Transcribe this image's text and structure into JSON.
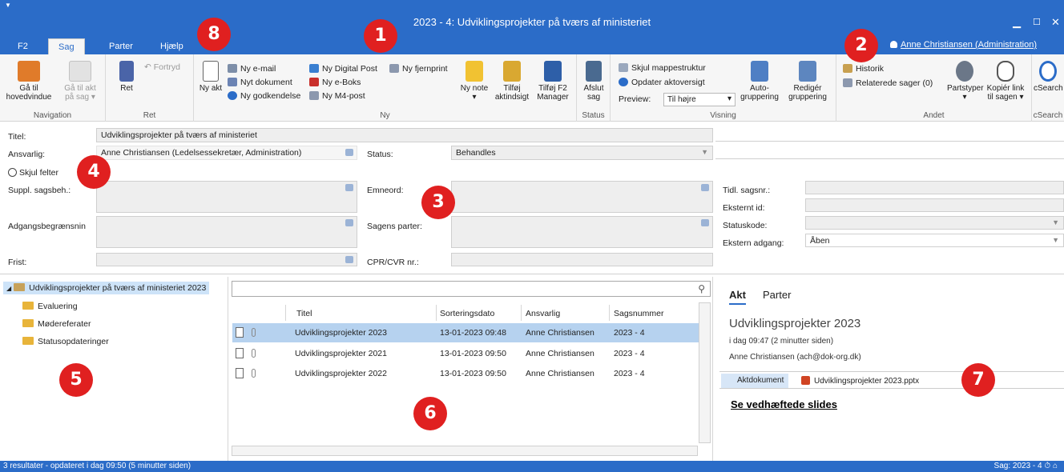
{
  "window": {
    "title": "2023 - 4: Udviklingsprojekter på tværs af ministeriet",
    "tabs": [
      {
        "label": "F2"
      },
      {
        "label": "Sag"
      },
      {
        "label": "Parter"
      },
      {
        "label": "Hjælp"
      }
    ],
    "user": "Anne Christiansen (Administration)"
  },
  "ribbon": {
    "navigation": {
      "label": "Navigation",
      "go_home": "Gå til hovedvindue",
      "go_akt": "Gå til akt på sag ▾"
    },
    "ret": {
      "label": "Ret",
      "ret": "Ret",
      "fortryd": "Fortryd"
    },
    "ny": {
      "label": "Ny",
      "ny_akt": "Ny akt",
      "ny_email": "Ny e-mail",
      "nyt_dokument": "Nyt dokument",
      "ny_godkendelse": "Ny godkendelse",
      "ny_digital_post": "Ny Digital Post",
      "ny_eboks": "Ny e-Boks",
      "ny_m4post": "Ny M4-post",
      "ny_fjernprint": "Ny fjernprint",
      "ny_note": "Ny note ▾",
      "tilfoej_aktindsigt": "Tilføj aktindsigt",
      "tilfoej_f2_manager": "Tilføj F2 Manager"
    },
    "status": {
      "label": "Status",
      "afslut_sag": "Afslut sag"
    },
    "visning": {
      "label": "Visning",
      "skjul_mappestruktur": "Skjul mappestruktur",
      "opdater_aktoversigt": "Opdater aktoversigt",
      "preview_label": "Preview:",
      "preview_value": "Til højre",
      "auto_gruppering": "Auto- gruppering",
      "rediger_gruppering": "Redigér gruppering"
    },
    "andet": {
      "label": "Andet",
      "historik": "Historik",
      "relaterede_sager": "Relaterede sager (0)",
      "partstyper": "Partstyper ▾",
      "kopier_link": "Kopiér link til sagen ▾"
    },
    "csearch": {
      "label": "cSearch",
      "csearch": "cSearch"
    }
  },
  "form": {
    "titel_label": "Titel:",
    "titel_value": "Udviklingsprojekter på tværs af ministeriet",
    "ansvarlig_label": "Ansvarlig:",
    "ansvarlig_value": "Anne Christiansen (Ledelsessekretær, Administration)",
    "status_label": "Status:",
    "status_value": "Behandles",
    "skjul_felter": "Skjul felter",
    "suppl_label": "Suppl. sagsbeh.:",
    "emneord_label": "Emneord:",
    "tidl_sagsnr_label": "Tidl. sagsnr.:",
    "eksternt_id_label": "Eksternt id:",
    "statuskode_label": "Statuskode:",
    "ekstern_adgang_label": "Ekstern adgang:",
    "ekstern_adgang_value": "Åben",
    "adgangsbegraensning_label": "Adgangsbegrænsnin",
    "sagens_parter_label": "Sagens parter:",
    "frist_label": "Frist:",
    "cpr_label": "CPR/CVR nr.:"
  },
  "tree": {
    "root": "Udviklingsprojekter på tværs af ministeriet 2023",
    "children": [
      "Evaluering",
      "Mødereferater",
      "Statusopdateringer"
    ]
  },
  "list": {
    "columns": [
      "Titel",
      "Sorteringsdato",
      "Ansvarlig",
      "Sagsnummer"
    ],
    "rows": [
      {
        "titel": "Udviklingsprojekter 2023",
        "dato": "13-01-2023 09:48",
        "ansvarlig": "Anne Christiansen",
        "sagsnummer": "2023 - 4"
      },
      {
        "titel": "Udviklingsprojekter 2021",
        "dato": "13-01-2023 09:50",
        "ansvarlig": "Anne Christiansen",
        "sagsnummer": "2023 - 4"
      },
      {
        "titel": "Udviklingsprojekter 2022",
        "dato": "13-01-2023 09:50",
        "ansvarlig": "Anne Christiansen",
        "sagsnummer": "2023 - 4"
      }
    ]
  },
  "preview": {
    "tabs": [
      "Akt",
      "Parter"
    ],
    "title": "Udviklingsprojekter 2023",
    "time": "i dag 09:47 (2 minutter siden)",
    "author": "Anne Christiansen (ach@dok-org.dk)",
    "aktdokument": "Aktdokument",
    "attachment": "Udviklingsprojekter 2023.pptx",
    "link": "Se vedhæftede slides"
  },
  "statusbar": {
    "left": "3 resultater - opdateret i dag 09:50 (5 minutter siden)",
    "right": "Sag: 2023 - 4"
  },
  "badges": [
    "1",
    "2",
    "3",
    "4",
    "5",
    "6",
    "7",
    "8"
  ],
  "colors": {
    "accent": "#2b6cc8",
    "badge": "#e02020",
    "selection": "#b6d2ef"
  }
}
